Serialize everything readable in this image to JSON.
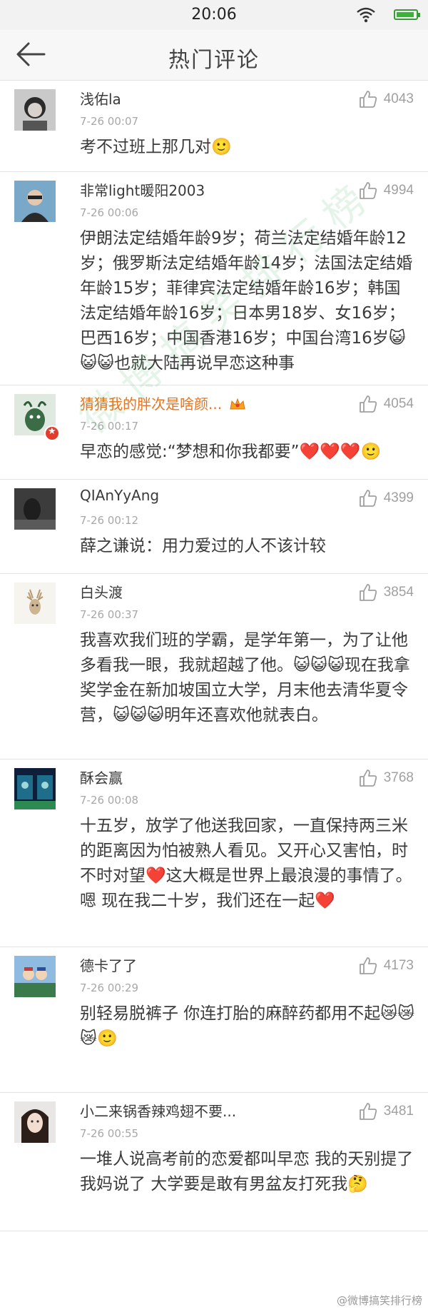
{
  "status_bar": {
    "time": "20:06"
  },
  "header": {
    "title": "热门评论"
  },
  "comments": [
    {
      "name": "浅佑la",
      "time": "7-26 00:07",
      "likes": "4043",
      "text": "考不过班上那几对🙂"
    },
    {
      "name": "非常light暖阳2003",
      "time": "7-26 00:06",
      "likes": "4994",
      "text": "伊朗法定结婚年龄9岁；荷兰法定结婚年龄12岁；俄罗斯法定结婚年龄14岁；法国法定结婚年龄15岁；菲律宾法定结婚年龄16岁；韩国法定结婚年龄16岁；日本男18岁、女16岁；巴西16岁；中国香港16岁；中国台湾16岁😺😺😺也就大陆再说早恋这种事"
    },
    {
      "name": "猜猜我的胖次是啥颜...",
      "time": "7-26 00:17",
      "likes": "4054",
      "text": "早恋的感觉:“梦想和你我都要”❤️❤️❤️🙂"
    },
    {
      "name": "QIAnYyAng",
      "time": "7-26 00:12",
      "likes": "4399",
      "text": "薛之谦说：用力爱过的人不该计较"
    },
    {
      "name": "白头渡",
      "time": "7-26 00:37",
      "likes": "3854",
      "text": "我喜欢我们班的学霸，是学年第一，为了让他多看我一眼，我就超越了他。😺😺😺现在我拿奖学金在新加坡国立大学，月末他去清华夏令营，😺😺😺明年还喜欢他就表白。"
    },
    {
      "name": "酥会赢",
      "time": "7-26 00:08",
      "likes": "3768",
      "text": "十五岁，放学了他送我回家，一直保持两三米的距离因为怕被熟人看见。又开心又害怕，时不时对望❤️这大概是世界上最浪漫的事情了。嗯 现在我二十岁，我们还在一起❤️"
    },
    {
      "name": "德卡了了",
      "time": "7-26 00:29",
      "likes": "4173",
      "text": "别轻易脱裤子 你连打胎的麻醉药都用不起😿😿😿🙂"
    },
    {
      "name": "小二来锅香辣鸡翅不要...",
      "time": "7-26 00:55",
      "likes": "3481",
      "text": "一堆人说高考前的恋爱都叫早恋 我的天别提了 我妈说了 大学要是敢有男盆友打死我🤔"
    }
  ],
  "watermark": "微博搞笑排行榜",
  "corner_watermark": "@微博搞笑排行榜",
  "colors": {
    "accent_vip": "#e8741e",
    "like_gray": "#a0a0a0",
    "status_battery": "#3bb33b"
  }
}
